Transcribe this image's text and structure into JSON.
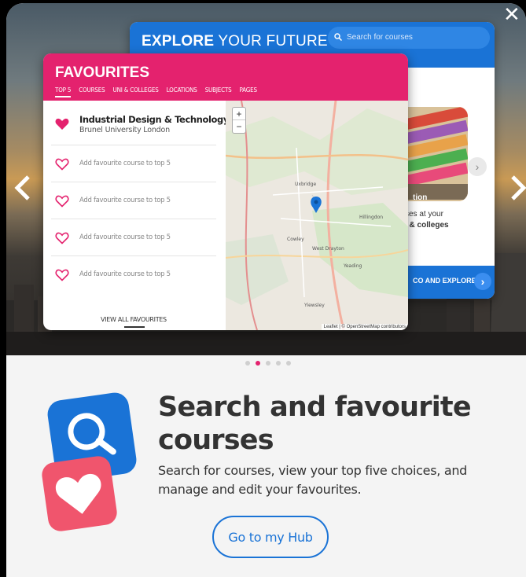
{
  "close_label": "✕",
  "explore": {
    "title_bold": "EXPLORE",
    "title_light": " YOUR FUTURE",
    "search_placeholder": "Search for courses",
    "tile_text": "tion",
    "caption_line1": "ses at your",
    "caption_line2": "i & colleges",
    "cta_label": "CO AND EXPLORE",
    "next_glyph": "›",
    "cta_glyph": "›"
  },
  "favourites": {
    "title": "FAVOURITES",
    "tabs": [
      "TOP 5",
      "COURSES",
      "UNI & COLLEGES",
      "LOCATIONS",
      "SUBJECTS",
      "PAGES"
    ],
    "course_name": "Industrial Design & Technology",
    "course_uni": "Brunel University London",
    "add_label": "Add favourite course to top 5",
    "view_all": "VIEW ALL FAVOURITES",
    "map_zoom_in": "+",
    "map_zoom_out": "−",
    "map_attribution": "Leaflet | © OpenStreetMap contributors",
    "map_places": [
      "Uxbridge",
      "Hillingdon",
      "Cowley",
      "West Drayton",
      "Yiewsley",
      "Yeading"
    ]
  },
  "pager": {
    "count": 5,
    "active": 1
  },
  "headline": "Search and favourite courses",
  "body_text": "Search for courses, view your top five choices, and manage and edit your favourites.",
  "hub_button": "Go to my Hub",
  "colors": {
    "brand_blue": "#1a73d6",
    "brand_pink": "#e4226e",
    "heart_red": "#f0556d"
  }
}
